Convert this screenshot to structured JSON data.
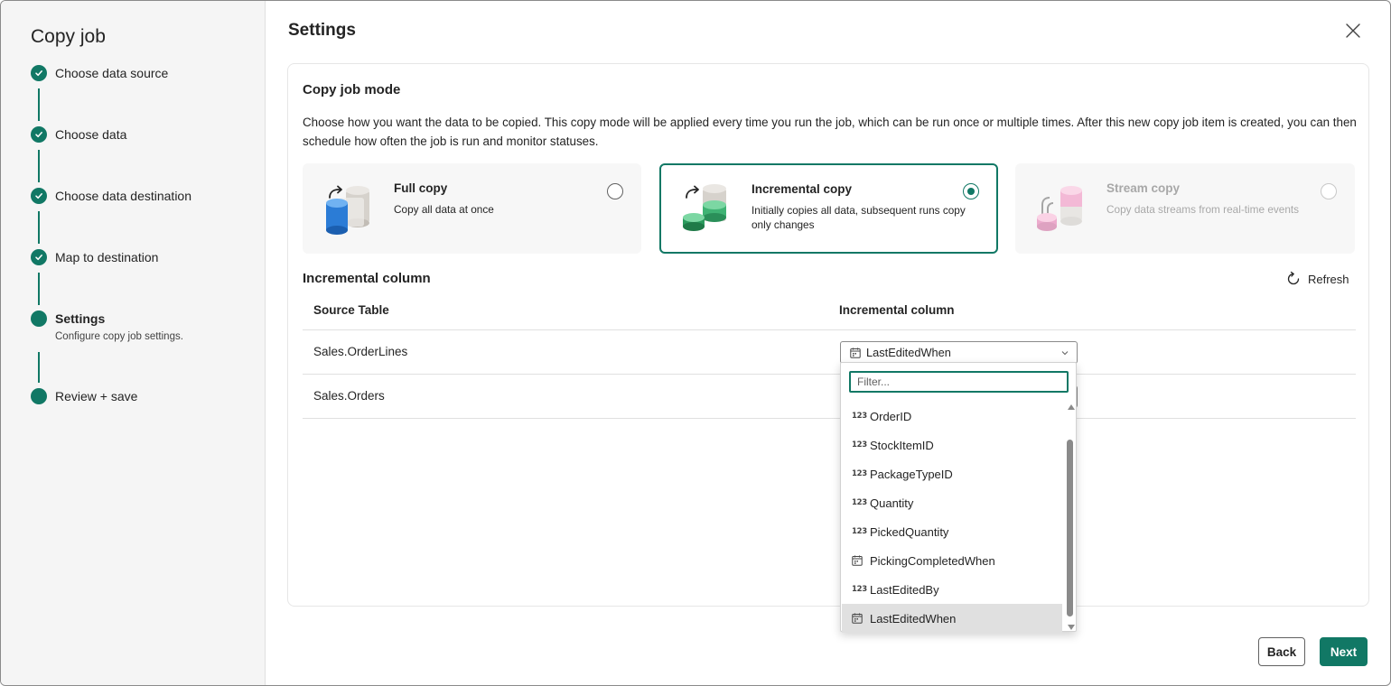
{
  "sidebar": {
    "title": "Copy job",
    "steps": [
      {
        "label": "Choose data source",
        "status": "done"
      },
      {
        "label": "Choose data",
        "status": "done"
      },
      {
        "label": "Choose data destination",
        "status": "done"
      },
      {
        "label": "Map to destination",
        "status": "done"
      },
      {
        "label": "Settings",
        "status": "current",
        "sublabel": "Configure copy job settings."
      },
      {
        "label": "Review + save",
        "status": "pending"
      }
    ]
  },
  "header": {
    "title": "Settings",
    "close_icon": "close-icon"
  },
  "copy_mode": {
    "title": "Copy job mode",
    "description": "Choose how you want the data to be copied. This copy mode will be applied every time you run the job, which can be run once or multiple times. After this new copy job item is created, you can then schedule how often the job is run and monitor statuses.",
    "options": [
      {
        "title": "Full copy",
        "description": "Copy all data at once",
        "selected": false,
        "disabled": false
      },
      {
        "title": "Incremental copy",
        "description": "Initially copies all data, subsequent runs copy only changes",
        "selected": true,
        "disabled": false
      },
      {
        "title": "Stream copy",
        "description": "Copy data streams from real-time events",
        "selected": false,
        "disabled": true
      }
    ]
  },
  "incremental": {
    "title": "Incremental column",
    "refresh_label": "Refresh",
    "columns": [
      "Source Table",
      "Incremental column"
    ],
    "rows": [
      {
        "source_table": "Sales.OrderLines",
        "incremental_column": "LastEditedWhen"
      },
      {
        "source_table": "Sales.Orders",
        "incremental_column": ""
      }
    ]
  },
  "dropdown": {
    "filter_placeholder": "Filter...",
    "options": [
      {
        "label": "OrderID",
        "type": "number"
      },
      {
        "label": "StockItemID",
        "type": "number"
      },
      {
        "label": "PackageTypeID",
        "type": "number"
      },
      {
        "label": "Quantity",
        "type": "number"
      },
      {
        "label": "PickedQuantity",
        "type": "number"
      },
      {
        "label": "PickingCompletedWhen",
        "type": "datetime"
      },
      {
        "label": "LastEditedBy",
        "type": "number"
      },
      {
        "label": "LastEditedWhen",
        "type": "datetime",
        "selected": true
      }
    ],
    "number_type_glyph": "123"
  },
  "footer": {
    "back_label": "Back",
    "next_label": "Next"
  },
  "colors": {
    "accent": "#117865",
    "sidebar_bg": "#f5f5f5",
    "disabled_text": "#a8a8a8"
  }
}
